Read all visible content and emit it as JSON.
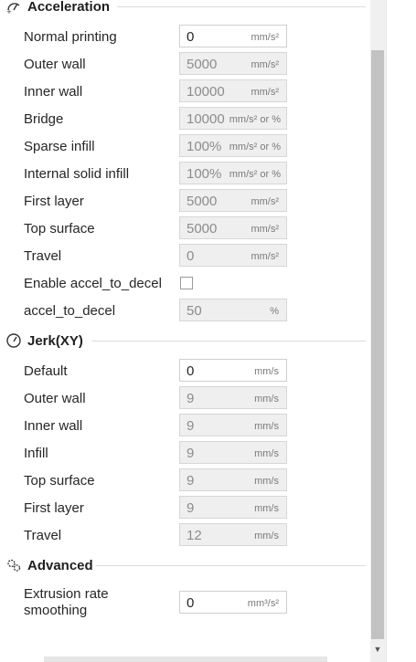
{
  "sections": {
    "acceleration": {
      "title": "Acceleration",
      "icon": "acceleration-icon"
    },
    "jerk": {
      "title": "Jerk(XY)",
      "icon": "gauge-icon"
    },
    "advanced": {
      "title": "Advanced",
      "icon": "gears-icon"
    }
  },
  "acceleration_rows": [
    {
      "label": "Normal printing",
      "value": "0",
      "unit": "mm/s²",
      "enabled": true
    },
    {
      "label": "Outer wall",
      "value": "5000",
      "unit": "mm/s²",
      "enabled": false
    },
    {
      "label": "Inner wall",
      "value": "10000",
      "unit": "mm/s²",
      "enabled": false
    },
    {
      "label": "Bridge",
      "value": "10000",
      "unit": "mm/s² or %",
      "enabled": false
    },
    {
      "label": "Sparse infill",
      "value": "100%",
      "unit": "mm/s² or %",
      "enabled": false
    },
    {
      "label": "Internal solid infill",
      "value": "100%",
      "unit": "mm/s² or %",
      "enabled": false
    },
    {
      "label": "First layer",
      "value": "5000",
      "unit": "mm/s²",
      "enabled": false
    },
    {
      "label": "Top surface",
      "value": "5000",
      "unit": "mm/s²",
      "enabled": false
    },
    {
      "label": "Travel",
      "value": "0",
      "unit": "mm/s²",
      "enabled": false
    }
  ],
  "accel_to_decel": {
    "enable_label": "Enable accel_to_decel",
    "enable_checked": false,
    "label": "accel_to_decel",
    "value": "50",
    "unit": "%"
  },
  "jerk_rows": [
    {
      "label": "Default",
      "value": "0",
      "unit": "mm/s",
      "enabled": true
    },
    {
      "label": "Outer wall",
      "value": "9",
      "unit": "mm/s",
      "enabled": false
    },
    {
      "label": "Inner wall",
      "value": "9",
      "unit": "mm/s",
      "enabled": false
    },
    {
      "label": "Infill",
      "value": "9",
      "unit": "mm/s",
      "enabled": false
    },
    {
      "label": "Top surface",
      "value": "9",
      "unit": "mm/s",
      "enabled": false
    },
    {
      "label": "First layer",
      "value": "9",
      "unit": "mm/s",
      "enabled": false
    },
    {
      "label": "Travel",
      "value": "12",
      "unit": "mm/s",
      "enabled": false
    }
  ],
  "advanced_rows": [
    {
      "label_line1": "Extrusion rate",
      "label_line2": "smoothing",
      "value": "0",
      "unit": "mm³/s²",
      "enabled": true
    }
  ]
}
